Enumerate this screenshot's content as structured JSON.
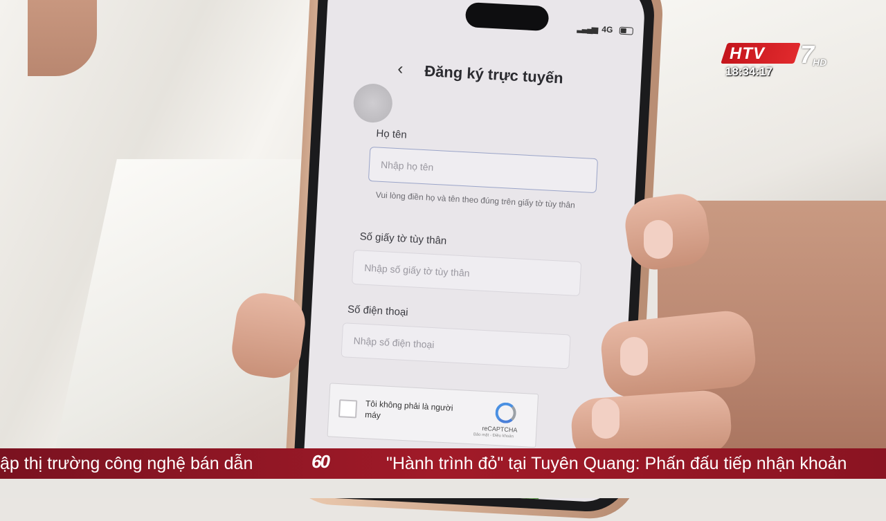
{
  "channel": {
    "logo_text": "HTV",
    "logo_number": "7",
    "logo_hd": "HD",
    "clock": "18:34:17"
  },
  "phone_status": {
    "network": "4G"
  },
  "form": {
    "title": "Đăng ký trực tuyến",
    "back_icon": "chevron-left-icon",
    "fields": [
      {
        "label": "Họ tên",
        "placeholder": "Nhập họ tên",
        "hint": "Vui lòng điền họ và tên theo đúng trên giấy tờ tùy thân"
      },
      {
        "label": "Số giấy tờ tùy thân",
        "placeholder": "Nhập số giấy tờ tùy thân"
      },
      {
        "label": "Số điện thoại",
        "placeholder": "Nhập số điện thoại"
      }
    ],
    "captcha": {
      "text": "Tôi không phải là người máy",
      "brand": "reCAPTCHA",
      "links": "Bảo mật - Điều khoản"
    }
  },
  "ticker": {
    "left_text": "ập thị trường công nghệ bán dẫn",
    "right_text": "\"Hành trình đỏ\" tại Tuyên Quang: Phấn đấu tiếp nhận khoản",
    "logo": "60"
  },
  "colors": {
    "ticker_bg": "#a11a28",
    "logo_red": "#d01f24",
    "field_border": "#9aa4c8"
  }
}
